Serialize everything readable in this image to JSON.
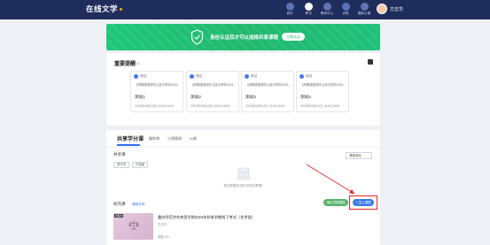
{
  "header": {
    "brand": "在线文学",
    "nav": [
      {
        "label": "首页",
        "icon": "home-icon",
        "active": false
      },
      {
        "label": "学习",
        "icon": "book-icon",
        "active": true
      },
      {
        "label": "教师中心",
        "icon": "teacher-icon",
        "active": false
      },
      {
        "label": "消息",
        "icon": "message-icon",
        "active": false
      },
      {
        "label": "题库云课",
        "icon": "cloud-icon",
        "active": false
      }
    ],
    "username": "方志华"
  },
  "banner": {
    "text": "身份认证后才可以选择共享课程",
    "button": "立即认证"
  },
  "reminders": {
    "title": "重要提醒",
    "count": "(4)",
    "items": [
      {
        "type": "测试",
        "course": "《简明语感测字以及中学科2024...",
        "name": "测试1",
        "time": "2024年09月13日 12:00-16:00"
      },
      {
        "type": "测试",
        "course": "《简明语感测字以及中学科2024...",
        "name": "测试2",
        "time": "2024年09月13日 15:00-18:00"
      },
      {
        "type": "测试",
        "course": "《简明语感测字以及中学科2024...",
        "name": "测试3",
        "time": "2024年09月14日 15:00-18:00"
      },
      {
        "type": "测试",
        "course": "《简明语感测字以及中学科2024...",
        "name": "测试4",
        "time": "2024年09月14日 15:00-18:00"
      }
    ]
  },
  "course": {
    "tabs": [
      "共享学分课",
      "翻转课",
      "小规模课",
      "AI课"
    ],
    "shared_label": "共享课",
    "chips": [
      "进行中",
      "已结束"
    ],
    "select_value": "课程选择",
    "empty_text": "您当前暂无进行中的共享课~",
    "school_label": "校内课",
    "school_link": "课程名称",
    "btn_green": "确认学期课程",
    "btn_blue": "+ 加入课程",
    "items": [
      {
        "tag": "课程中",
        "title": "重庆师范涉外商贸学院2024年秋季学期线下考试（艺术类）",
        "teacher": "方志华",
        "progress": "进度 0%"
      }
    ]
  }
}
